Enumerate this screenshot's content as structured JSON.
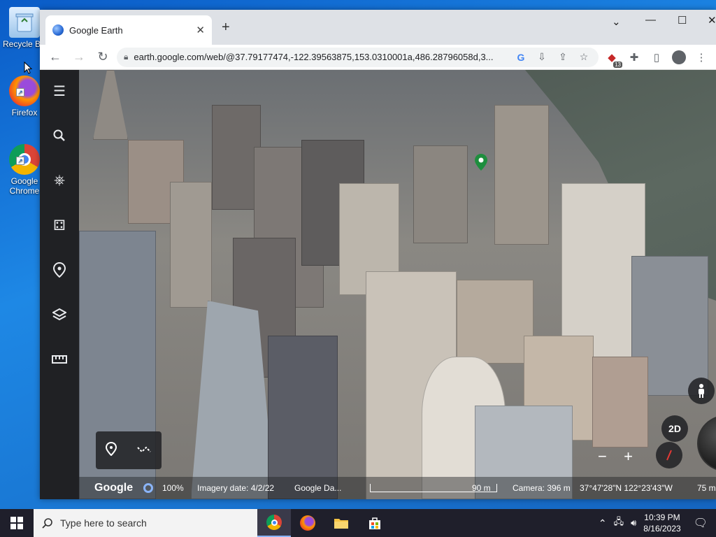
{
  "desktop": {
    "icons": [
      {
        "label": "Recycle Bin",
        "icon": "recycle-bin-icon"
      },
      {
        "label": "Firefox",
        "icon": "firefox-icon"
      },
      {
        "label": "Google Chrome",
        "icon": "chrome-icon"
      }
    ]
  },
  "browser": {
    "tab_title": "Google Earth",
    "url": "earth.google.com/web/@37.79177474,-122.39563875,153.0310001a,486.28796058d,3...",
    "extension_badge": "13"
  },
  "earth": {
    "sidebar": [
      {
        "name": "menu-icon",
        "glyph": "☰"
      },
      {
        "name": "search-icon",
        "glyph": "⌕"
      },
      {
        "name": "voyager-icon",
        "glyph": "⎈"
      },
      {
        "name": "feeling-lucky-icon",
        "glyph": "⚃"
      },
      {
        "name": "projects-icon",
        "glyph": "⌖"
      },
      {
        "name": "map-style-icon",
        "glyph": "◈"
      },
      {
        "name": "measure-icon",
        "glyph": "▭"
      }
    ],
    "map_view_mode": "2D",
    "status": {
      "logo": "Google",
      "load_percent": "100%",
      "imagery_date": "Imagery date: 4/2/22",
      "attribution": "Google   Da...",
      "scale": "90 m",
      "camera": "Camera: 396 m",
      "coords": "37°47'28\"N 122°23'43\"W",
      "elevation": "75 m"
    }
  },
  "taskbar": {
    "search_placeholder": "Type here to search",
    "time": "10:39 PM",
    "date": "8/16/2023"
  }
}
